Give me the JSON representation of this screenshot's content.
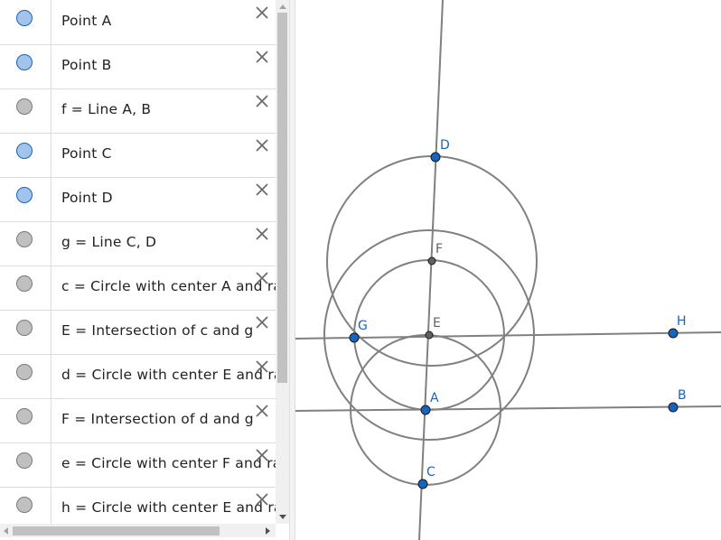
{
  "algebra_view": {
    "items": [
      {
        "label": "Point A",
        "visible": true
      },
      {
        "label": "Point B",
        "visible": true
      },
      {
        "label": "f = Line A, B",
        "visible": false
      },
      {
        "label": "Point C",
        "visible": true
      },
      {
        "label": "Point D",
        "visible": true
      },
      {
        "label": "g = Line C, D",
        "visible": false
      },
      {
        "label": "c = Circle with center A and ra",
        "visible": false
      },
      {
        "label": "E = Intersection of c and g",
        "visible": false
      },
      {
        "label": "d = Circle with center E and ra",
        "visible": false
      },
      {
        "label": "F = Intersection of d and g",
        "visible": false
      },
      {
        "label": "e = Circle with center F and ra",
        "visible": false
      },
      {
        "label": "h = Circle with center E and ra",
        "visible": false
      }
    ],
    "close_icon": "close-icon"
  },
  "graphics_view": {
    "colors": {
      "free_point": "#1565c0",
      "dependent_point": "#616161",
      "object_stroke": "#808080",
      "free_label": "#1565c0",
      "dependent_label": "#616161"
    },
    "points": [
      {
        "name": "A",
        "free": true
      },
      {
        "name": "B",
        "free": true
      },
      {
        "name": "C",
        "free": true
      },
      {
        "name": "D",
        "free": true
      },
      {
        "name": "E",
        "free": false
      },
      {
        "name": "F",
        "free": false
      },
      {
        "name": "G",
        "free": true
      },
      {
        "name": "H",
        "free": true
      }
    ]
  }
}
